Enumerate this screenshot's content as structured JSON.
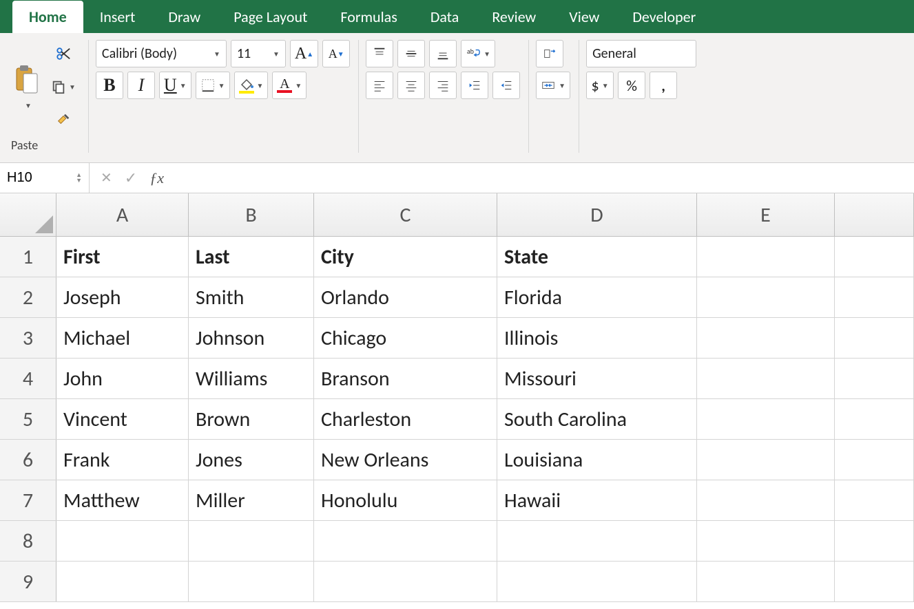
{
  "tabs": [
    "Home",
    "Insert",
    "Draw",
    "Page Layout",
    "Formulas",
    "Data",
    "Review",
    "View",
    "Developer"
  ],
  "active_tab": "Home",
  "clipboard": {
    "paste_label": "Paste"
  },
  "font": {
    "name": "Calibri (Body)",
    "size": "11",
    "bold": "B",
    "italic": "I",
    "underline": "U",
    "grow": "A",
    "shrink": "A",
    "fill": "A",
    "font_color": "A"
  },
  "number": {
    "format": "General",
    "currency": "$",
    "percent": "%"
  },
  "namebox": "H10",
  "formula": "",
  "columns": [
    "A",
    "B",
    "C",
    "D",
    "E"
  ],
  "row_count": 9,
  "headers": [
    "First",
    "Last",
    "City",
    "State"
  ],
  "rows": [
    [
      "Joseph",
      "Smith",
      "Orlando",
      "Florida"
    ],
    [
      "Michael",
      "Johnson",
      "Chicago",
      "Illinois"
    ],
    [
      "John",
      "Williams",
      "Branson",
      "Missouri"
    ],
    [
      "Vincent",
      "Brown",
      "Charleston",
      "South Carolina"
    ],
    [
      "Frank",
      "Jones",
      "New Orleans",
      "Louisiana"
    ],
    [
      "Matthew",
      "Miller",
      "Honolulu",
      "Hawaii"
    ]
  ]
}
